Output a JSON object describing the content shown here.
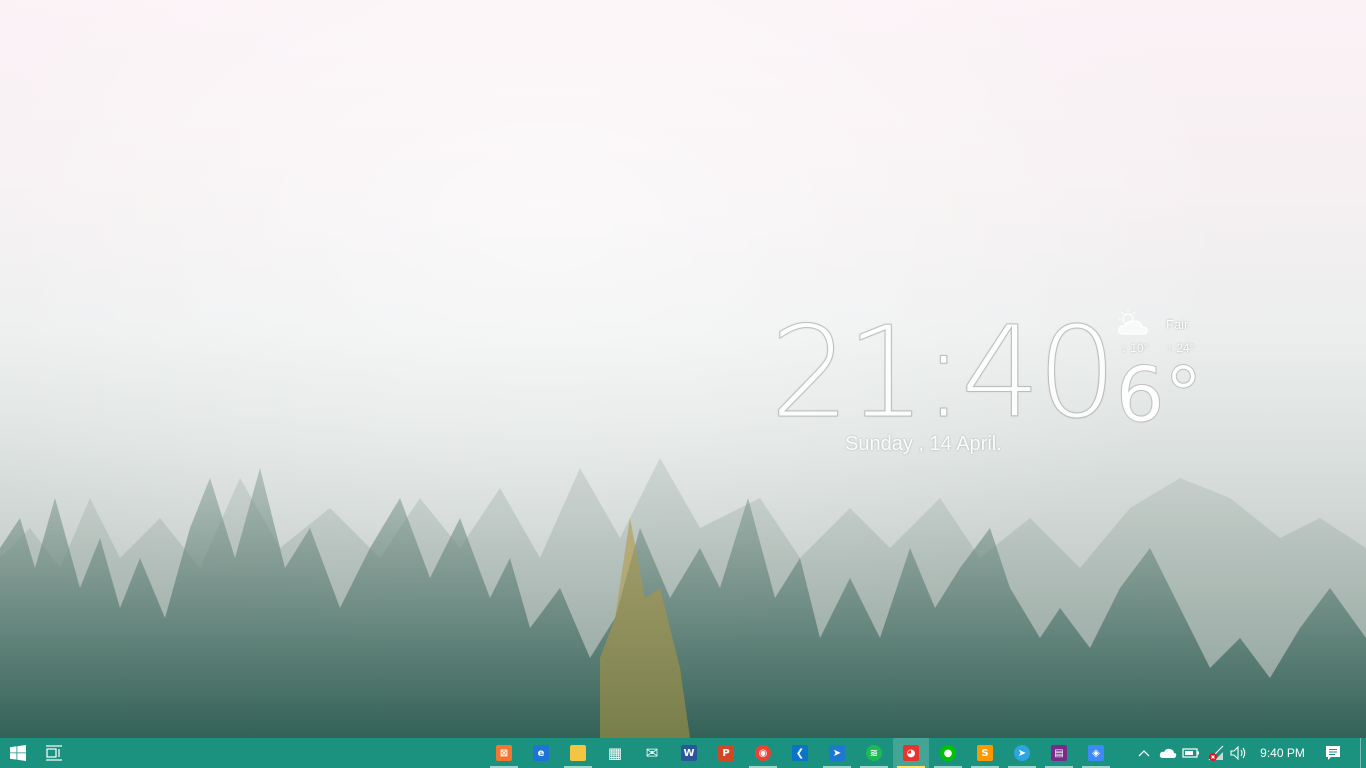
{
  "widget": {
    "time": "21:40",
    "date": "Sunday , 14 April.",
    "temperature": "6°",
    "condition": "Fair",
    "low": "↓ 10°",
    "high": "↑ 24°",
    "weather_icon": "partly-cloudy-icon"
  },
  "taskbar": {
    "apps": [
      {
        "name": "xampp",
        "icon": "xampp-icon",
        "color": "#f2762e",
        "glyph": "⊠"
      },
      {
        "name": "edge",
        "icon": "edge-icon",
        "color": "#1e73d6",
        "glyph": "e"
      },
      {
        "name": "file-explorer",
        "icon": "folder-icon",
        "color": "#f4c542",
        "glyph": ""
      },
      {
        "name": "store",
        "icon": "store-icon",
        "color": "#ffffff",
        "glyph": "▦"
      },
      {
        "name": "mail",
        "icon": "mail-icon",
        "color": "#ffffff",
        "glyph": "✉"
      },
      {
        "name": "word",
        "icon": "word-icon",
        "color": "#2b579a",
        "glyph": "W"
      },
      {
        "name": "powerpoint",
        "icon": "powerpoint-icon",
        "color": "#d24726",
        "glyph": "P"
      },
      {
        "name": "chrome",
        "icon": "chrome-icon",
        "color": "#ea4335",
        "glyph": "◉"
      },
      {
        "name": "vscode",
        "icon": "vscode-icon",
        "color": "#0a74c7",
        "glyph": "❮"
      },
      {
        "name": "app-blue",
        "icon": "arrow-app-icon",
        "color": "#1e78d0",
        "glyph": "➤"
      },
      {
        "name": "spotify",
        "icon": "spotify-icon",
        "color": "#1db954",
        "glyph": "≋"
      },
      {
        "name": "app-red",
        "icon": "red-app-icon",
        "color": "#e8342f",
        "glyph": "◕"
      },
      {
        "name": "line",
        "icon": "line-chat-icon",
        "color": "#00c300",
        "glyph": "●"
      },
      {
        "name": "sublime",
        "icon": "sublime-icon",
        "color": "#ff9800",
        "glyph": "S"
      },
      {
        "name": "telegram",
        "icon": "telegram-icon",
        "color": "#2ca5e0",
        "glyph": "➤"
      },
      {
        "name": "winrar",
        "icon": "archive-icon",
        "color": "#7a2a8a",
        "glyph": "▤"
      },
      {
        "name": "sourcetree",
        "icon": "git-icon",
        "color": "#3d8af7",
        "glyph": "◈"
      }
    ],
    "clock": "9:40 PM"
  },
  "colors": {
    "taskbar": "#1b9280",
    "active_indicator": "#ffe270",
    "running_indicator": "#9fd6cc"
  }
}
